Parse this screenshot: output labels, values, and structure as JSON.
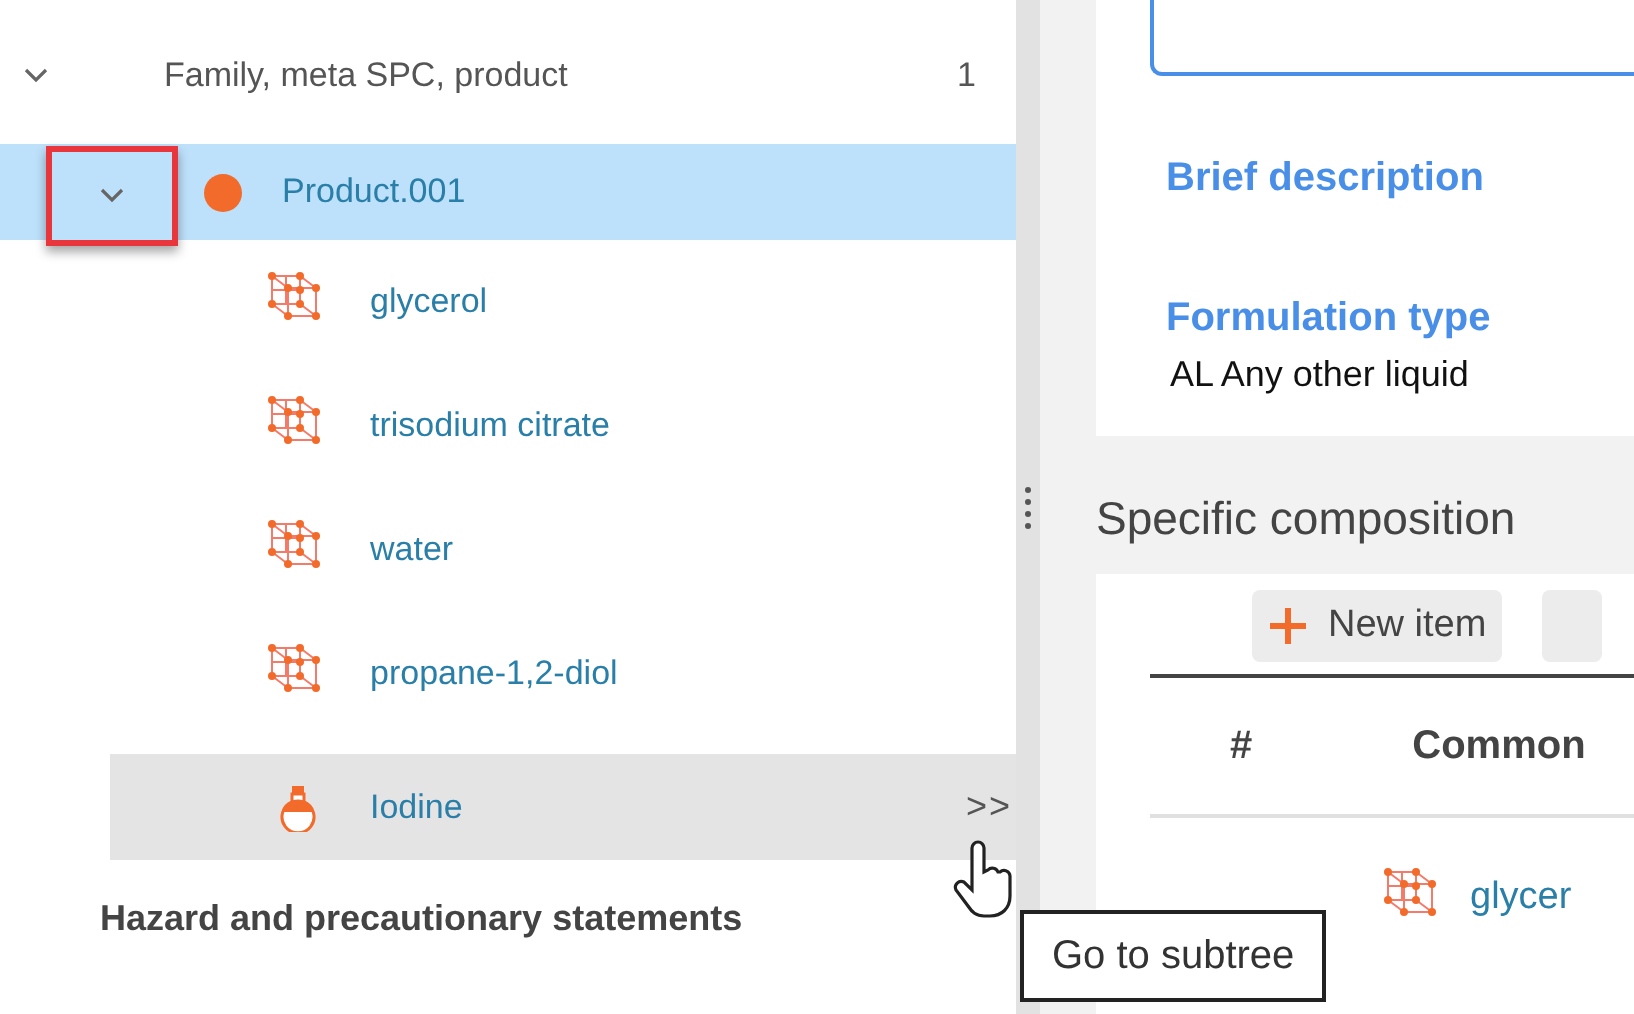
{
  "tree": [
    {
      "label": "Family, meta SPC, product",
      "count": "1",
      "expanded": true,
      "children": [
        {
          "label": "Product.001",
          "kind": "product",
          "selected": true,
          "expanded": true,
          "emphasized": true,
          "children": [
            {
              "label": "glycerol",
              "kind": "substance",
              "selected": false,
              "hovered": false
            },
            {
              "label": "trisodium citrate",
              "kind": "substance",
              "selected": false,
              "hovered": false
            },
            {
              "label": "water",
              "kind": "substance",
              "selected": false,
              "hovered": false
            },
            {
              "label": "propane-1,2-diol",
              "kind": "substance",
              "selected": false,
              "hovered": false
            },
            {
              "label": "Iodine",
              "kind": "mixture",
              "selected": false,
              "hovered": true,
              "subtree_link": ">>"
            }
          ]
        }
      ]
    }
  ],
  "section_heading": "Hazard and precautionary statements",
  "tooltip": "Go to subtree",
  "form": {
    "fields": [
      {
        "label": "Brief description"
      },
      {
        "label": "Formulation type",
        "value": "AL Any other liquid"
      }
    ]
  },
  "composition": {
    "title": "Specific composition",
    "new_button": "New item",
    "columns": [
      "#",
      "Common"
    ],
    "rows": [
      {
        "name": "glycer"
      }
    ]
  }
}
